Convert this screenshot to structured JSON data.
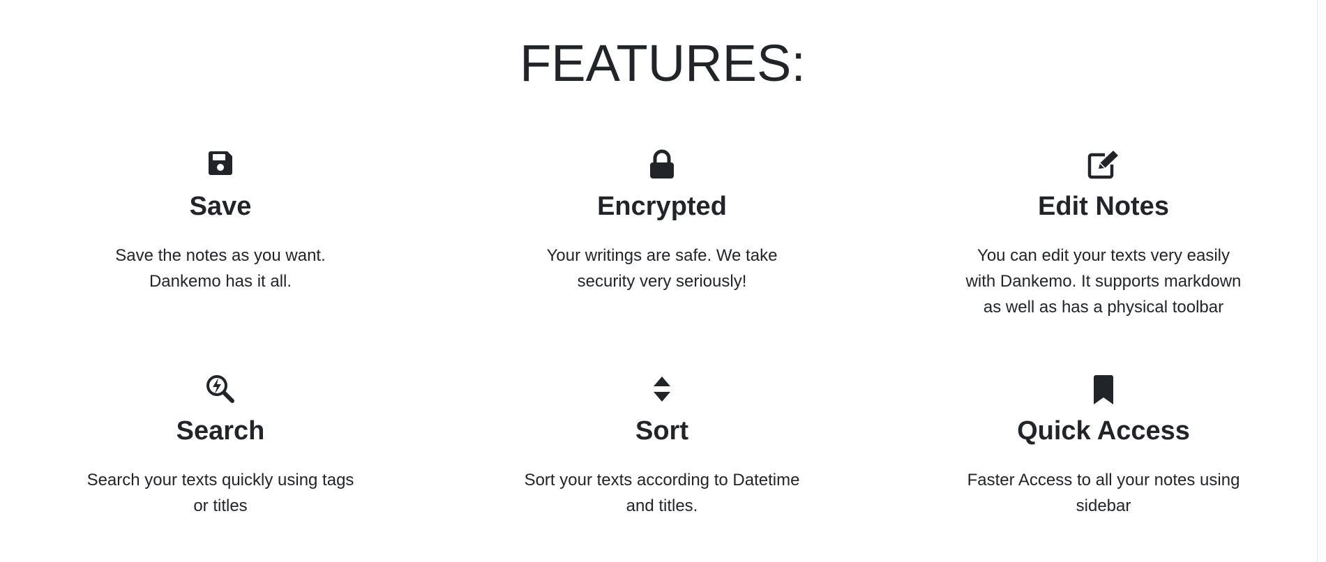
{
  "section": {
    "title": "FEATURES:"
  },
  "features": [
    {
      "icon": "floppy-disk-icon",
      "title": "Save",
      "description": "Save the notes as you want. Dankemo has it all."
    },
    {
      "icon": "lock-icon",
      "title": "Encrypted",
      "description": "Your writings are safe. We take security very seriously!"
    },
    {
      "icon": "edit-icon",
      "title": "Edit Notes",
      "description": "You can edit your texts very easily with Dankemo. It supports markdown as well as has a physical toolbar"
    },
    {
      "icon": "search-bolt-icon",
      "title": "Search",
      "description": "Search your texts quickly using tags or titles"
    },
    {
      "icon": "sort-icon",
      "title": "Sort",
      "description": "Sort your texts according to Datetime and titles."
    },
    {
      "icon": "bookmark-icon",
      "title": "Quick Access",
      "description": "Faster Access to all your notes using sidebar"
    }
  ],
  "colors": {
    "text": "#212529",
    "background": "#ffffff"
  }
}
